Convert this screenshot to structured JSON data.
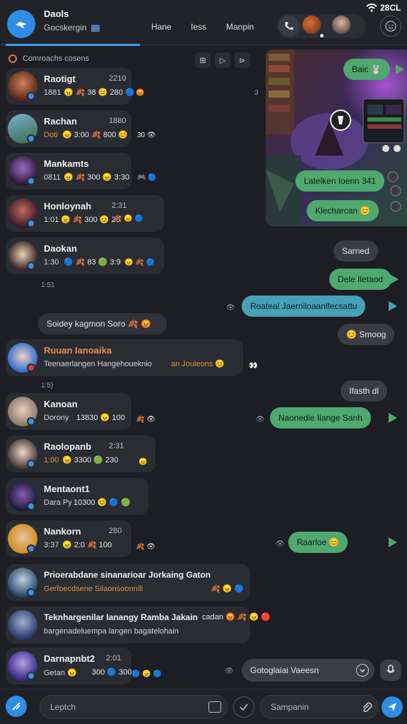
{
  "header": {
    "app_title": "Daols",
    "app_subtitle": "Gocskergin",
    "tabs": [
      "Hane",
      "Iess",
      "Manpin"
    ],
    "status_time": "28CL",
    "status_icon": "wifi-icon"
  },
  "filter": {
    "label": "Comroachs cosens",
    "btn_a": "⊞",
    "btn_b": "▷",
    "btn_c": "⊳"
  },
  "chats": [
    {
      "name": "Raotigt",
      "time": "2210",
      "preview": "1881",
      "emojis": "😠 🍂 38 😊 280 🔵",
      "side": "😡",
      "avatar": "#b35a2a"
    },
    {
      "name": "Rachan",
      "time": "1880",
      "preview": "Doti",
      "emojis": "😠 3:00 🍂 800 😊",
      "side": "30 👁",
      "avatar": "#4a7a4a"
    },
    {
      "name": "Mankamts",
      "time": "",
      "preview": "0811",
      "emojis": "😠 🍂 300 😠 3:30",
      "side": "🎮 🔵",
      "avatar": "#6a3a7a"
    },
    {
      "name": "Honloynah",
      "time": "2:31",
      "preview": "1:01",
      "emojis": "😠 🍂 300 😊 26",
      "side": "🍂 😠 🔵",
      "avatar": "#7a3a4a"
    },
    {
      "name": "Daokan",
      "time": "",
      "preview": "1:30",
      "emojis": "🔵 🍂 83 🟢 3:9",
      "side": "😠 🍂 🔵",
      "avatar": "#e0c0a0"
    },
    {
      "name": "Ruuan Ianoaika",
      "time": "",
      "preview": "Teenaerlangen Hangehoueknio",
      "emojis": "an Jouleons 😊",
      "side": "👀",
      "avatar": "#3a7ad0"
    },
    {
      "name": "Kanoan",
      "time": "",
      "preview": "Dorony",
      "emojis": "13830 😠 100",
      "side": "🍂 👁",
      "avatar": "#c0a890"
    },
    {
      "name": "Raolopanb",
      "time": "2:31",
      "preview": "1:00",
      "emojis": "😠 3300 🟢 230",
      "side": "😠",
      "avatar": "#d0b0a0"
    },
    {
      "name": "Mentaont1",
      "time": "",
      "preview": "Dara Py",
      "emojis": "10300 😊 🔵 🟢",
      "side": "",
      "avatar": "#5a3a6a"
    },
    {
      "name": "Nankorn",
      "time": "280",
      "preview": "3:37",
      "emojis": "😠 2:0 🍂 100",
      "side": "🍂 👁",
      "avatar": "#e0a030"
    },
    {
      "name": "Prioerabdane sinanarioar Jorkaing Gaton",
      "time": "",
      "preview": "Gerfoecdsene Silaonsoonnill",
      "emojis": "🍂 😠 🔵",
      "side": "",
      "avatar": "#4a6a8a"
    },
    {
      "name": "Teknhargenilar Ianangy Ramba Jakain",
      "time": "",
      "preview": "bargenadeluempa langen bagatelohain",
      "emojis": "cadan 😡 🍂 😠 🔴",
      "side": "",
      "avatar": "#3a5a8a"
    },
    {
      "name": "Darnapnbt2",
      "time": "2:01",
      "preview": "Getan 😠",
      "emojis": "300 🔵 300",
      "side": "🔵 😠 🔵",
      "avatar": "#4a4aa0"
    }
  ],
  "bubbles": {
    "b1": "Baic 🐰",
    "b2": "Latelken Ioenn 341",
    "b3": "Klecharcan 😊",
    "b4": "Sarned",
    "b5": "Dele Iletaod",
    "b6": "Roateal Jaerniloaanlfecsattu",
    "b7": "😊 Smoog",
    "b8": "Ifasth dl",
    "b9": "Naonedie Iiange Sanh",
    "b10": "Raarloe 😊"
  },
  "markers": {
    "m1": "1:51",
    "m2": "1:5)",
    "m3": "3",
    "m4": "👁",
    "m5": "👁",
    "m6": "👁",
    "m7": "👁"
  },
  "system": {
    "pill": "Soidey kagmon Soro 🍂 😡"
  },
  "controls": {
    "suggest": "Gotoglaiai Vaeesn"
  },
  "composer": {
    "left_placeholder": "Leptch",
    "right_placeholder": "Sampanin"
  },
  "colors": {
    "accent": "#3e9be8",
    "bubble_green": "#4fa86e",
    "bubble_teal": "#46a0b6",
    "card_bg": "#2a2c33",
    "page_bg": "#1c1e24"
  },
  "icons": {
    "logo": "bird-icon",
    "call": "phone-icon",
    "profile": "smile-icon",
    "compose": "feather-icon",
    "send": "paper-plane-icon",
    "attach": "paperclip-icon",
    "media": "image-icon",
    "emoji": "check-icon",
    "mic": "mic-icon"
  }
}
